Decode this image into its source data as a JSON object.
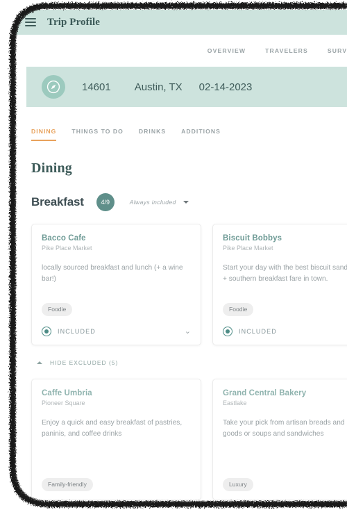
{
  "appbar": {
    "menu_icon": "hamburger-icon",
    "title": "Trip Profile"
  },
  "nav": {
    "items": [
      {
        "label": "OVERVIEW"
      },
      {
        "label": "TRAVELERS"
      },
      {
        "label": "SURVEY"
      }
    ]
  },
  "banner": {
    "icon": "compass-icon",
    "trip_id": "14601",
    "location": "Austin, TX",
    "date": "02-14-2023",
    "bg_color": "#cde3dd",
    "icon_bg_color": "#9ccabe"
  },
  "tabs": [
    {
      "label": "DINING",
      "active": true
    },
    {
      "label": "THINGS TO DO",
      "active": false
    },
    {
      "label": "DRINKS",
      "active": false
    },
    {
      "label": "ADDITIONS",
      "active": false
    }
  ],
  "section": {
    "title": "Dining",
    "accent_color": "#e8a25c"
  },
  "group": {
    "name": "Breakfast",
    "count_badge": "4/9",
    "badge_color": "#5f8f8a",
    "always_included_label": "Always included",
    "dropdown_icon": "chevron-down-icon"
  },
  "included_cards": [
    {
      "title": "Bacco Cafe",
      "subtitle": "Pike Place Market",
      "description": "locally sourced breakfast and lunch (+ a wine bar!)",
      "tag": "Foodie",
      "status_label": "INCLUDED",
      "status_selected": true,
      "expand_icon": "chevron-down-icon"
    },
    {
      "title": "Biscuit Bobbys",
      "subtitle": "Pike Place Market",
      "description": "Start your day with the best biscuit sandwiches + southern breakfast fare in town.",
      "tag": "Foodie",
      "status_label": "INCLUDED",
      "status_selected": true,
      "expand_icon": "chevron-down-icon"
    }
  ],
  "excluded_toggle": {
    "label": "HIDE EXCLUDED (5)",
    "icon": "chevron-up-icon"
  },
  "excluded_cards": [
    {
      "title": "Caffe Umbria",
      "subtitle": "Pioneer Square",
      "description": "Enjoy a quick and easy breakfast of pastries, paninis, and coffee drinks",
      "tag": "Family-friendly"
    },
    {
      "title": "Grand Central Bakery",
      "subtitle": "Eastlake",
      "description": "Take your pick from artisan breads and baked goods or soups and sandwiches",
      "tag": "Luxury"
    }
  ]
}
